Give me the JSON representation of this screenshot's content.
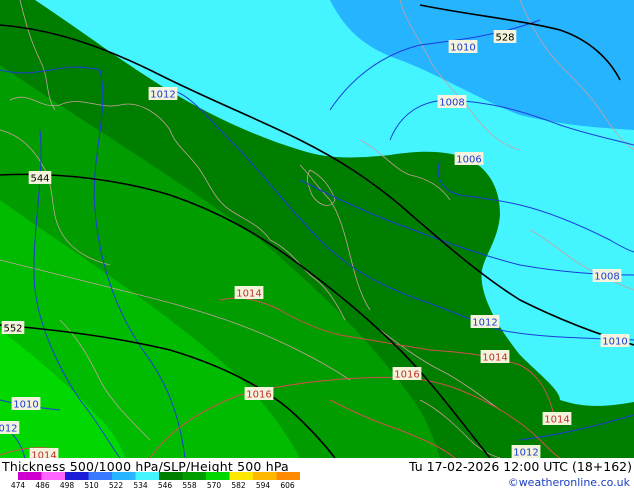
{
  "footer": {
    "title": "Thickness 500/1000 hPa/SLP/Height 500 hPa",
    "datetime": "Tu 17-02-2026 12:00 UTC (18+162)",
    "credit": "©weatheronline.co.uk"
  },
  "legend": {
    "ticks": [
      "474",
      "486",
      "498",
      "510",
      "522",
      "534",
      "546",
      "558",
      "570",
      "582",
      "594",
      "606"
    ],
    "colors": [
      "#d000d0",
      "#ff66ff",
      "#1c1cd8",
      "#3a78ff",
      "#28b4ff",
      "#44f4ff",
      "#007e00",
      "#009c00",
      "#00d800",
      "#ffe800",
      "#ffb800",
      "#ff8a00"
    ]
  },
  "map": {
    "fill_colors": {
      "blue": "#26b4ff",
      "cyan": "#44f4ff",
      "dark_green": "#007e00",
      "green": "#009c00",
      "light_green": "#00bb00",
      "bright_green": "#00d800"
    },
    "line_colors": {
      "height500": "#000000",
      "isobar_low": "#1c3cd8",
      "isobar_high": "#d05050",
      "borders": "#c8a0a0"
    },
    "height_labels": [
      "528",
      "544",
      "552"
    ],
    "isobar_labels": [
      "1010",
      "1012",
      "1008",
      "1006",
      "1008",
      "1012",
      "1010",
      "1014",
      "1014",
      "1016",
      "1016",
      "1014",
      "1010",
      "012",
      "1012",
      "1014"
    ]
  }
}
